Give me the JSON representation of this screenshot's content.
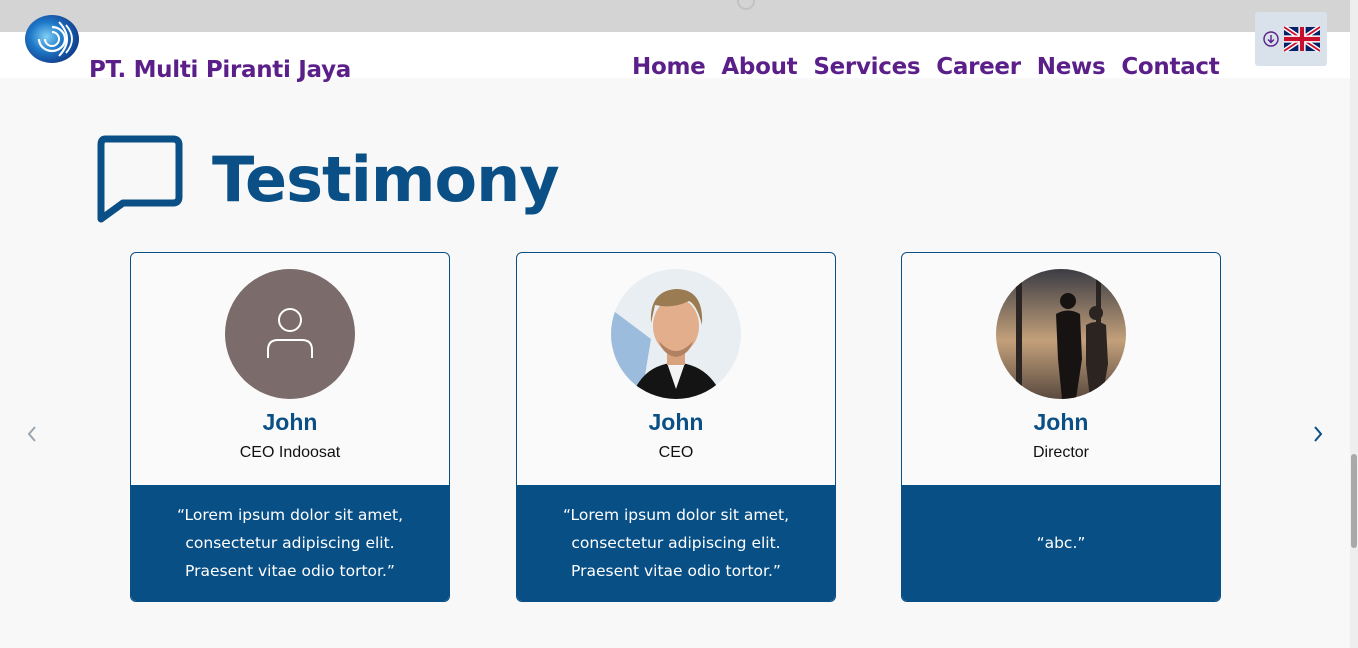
{
  "brand": {
    "name": "PT. Multi Piranti Jaya",
    "logo_icon": "swirl-logo-icon"
  },
  "nav": {
    "items": [
      "Home",
      "About",
      "Services",
      "Career",
      "News",
      "Contact"
    ]
  },
  "language": {
    "icon": "download-circle-icon",
    "flag": "uk-flag-icon"
  },
  "section": {
    "title": "Testimony",
    "icon": "chat-bubble-icon"
  },
  "carousel": {
    "prev_icon": "chevron-left-icon",
    "next_icon": "chevron-right-icon"
  },
  "testimonials": [
    {
      "name": "John",
      "role": "CEO Indoosat",
      "quote": "“Lorem ipsum dolor sit amet, consectetur adipiscing elit. Praesent vitae odio tortor.”",
      "avatar": "default-user-avatar"
    },
    {
      "name": "John",
      "role": "CEO",
      "quote": "“Lorem ipsum dolor sit amet, consectetur adipiscing elit. Praesent vitae odio tortor.”",
      "avatar": "portrait-photo"
    },
    {
      "name": "John",
      "role": "Director",
      "quote": "“abc.”",
      "avatar": "silhouette-photo"
    }
  ],
  "colors": {
    "brand_purple": "#5b1f8a",
    "primary_blue": "#0a4f86",
    "quote_bg": "#084f86",
    "avatar_grey": "#7b6b6b"
  }
}
